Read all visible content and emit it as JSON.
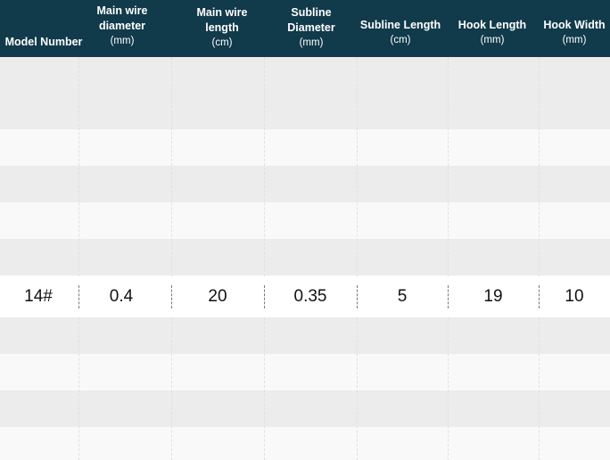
{
  "table": {
    "headers": [
      {
        "line1": "Model Number",
        "line2": "",
        "unit": ""
      },
      {
        "line1": "Main wire",
        "line2": "diameter",
        "unit": "(mm)"
      },
      {
        "line1": "Main wire",
        "line2": "length",
        "unit": "(cm)"
      },
      {
        "line1": "Subline",
        "line2": "Diameter",
        "unit": "(mm)"
      },
      {
        "line1": "Subline Length",
        "line2": "",
        "unit": "(cm)"
      },
      {
        "line1": "Hook Length",
        "line2": "",
        "unit": "(mm)"
      },
      {
        "line1": "Hook Width",
        "line2": "",
        "unit": "(mm)"
      }
    ],
    "highlighted_row": [
      "14#",
      "0.4",
      "20",
      "0.35",
      "5",
      "19",
      "10"
    ]
  },
  "colors": {
    "header_bg": "#113a4b",
    "header_text": "#ffffff",
    "row_shade": "#ececec",
    "row_light": "#f9f9f9"
  }
}
